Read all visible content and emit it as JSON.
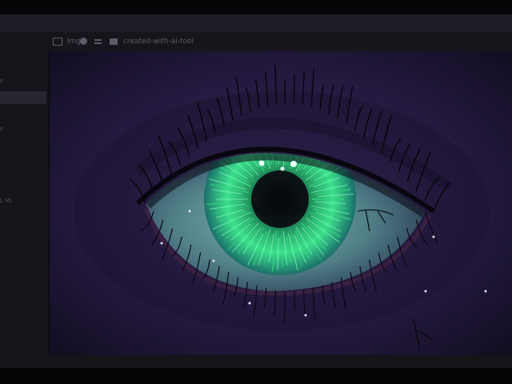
{
  "toolbar": {
    "items": [
      {
        "icon": "image-icon",
        "label": "Img"
      },
      {
        "icon": "globe-icon",
        "label": ""
      },
      {
        "icon": "grid-icon",
        "label": ""
      },
      {
        "icon": "folder-icon",
        "label": "created-with-ai-tool"
      }
    ]
  },
  "sidebar": {
    "items": [
      {
        "label": "s"
      },
      {
        "label": ""
      },
      {
        "label": "s"
      },
      {
        "label": "L ML"
      }
    ]
  },
  "image": {
    "subject": "eye-illustration",
    "colors": {
      "background": "#1d1434",
      "skin": "#3a2a5e",
      "iris": "#3fe38f",
      "pupil": "#050608",
      "sclera": "#6fa4a0"
    }
  },
  "statusbar": {
    "text": ""
  }
}
